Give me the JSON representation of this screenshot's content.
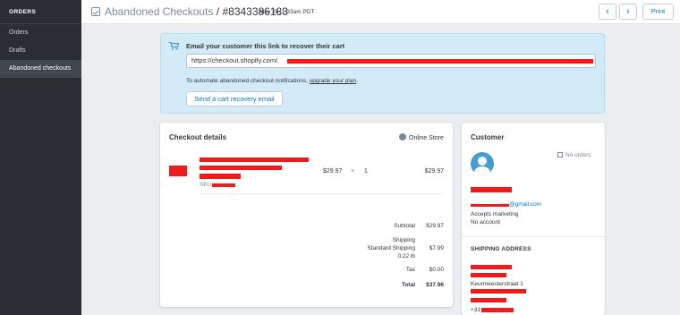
{
  "sidebar": {
    "header": "ORDERS",
    "items": [
      {
        "label": "Orders"
      },
      {
        "label": "Drafts"
      },
      {
        "label": "Abandoned checkouts"
      }
    ]
  },
  "topbar": {
    "breadcrumb": "Abandoned Checkouts",
    "separator": "/",
    "checkout_id": "#8343386183",
    "date": "May 26, 1:33am PDT",
    "prev_glyph": "‹",
    "next_glyph": "›",
    "print_label": "Print"
  },
  "recovery": {
    "title": "Email your customer this link to recover their cart",
    "link_value": "https://checkout.shopify.com/",
    "note_prefix": "To automate abandoned checkout notifications, ",
    "note_link": "upgrade your plan",
    "note_suffix": ".",
    "button_label": "Send a cart recovery email"
  },
  "checkout_details": {
    "title": "Checkout details",
    "channel": "Online Store",
    "line_item": {
      "sku_label": "SKU:",
      "price": "$29.97",
      "times": "×",
      "quantity": "1",
      "total": "$29.97"
    },
    "summary": {
      "subtotal_label": "Subtotal",
      "subtotal_value": "$29.97",
      "shipping_label": "Shipping",
      "shipping_method": "Standard Shipping",
      "shipping_weight": "0.22 lb",
      "shipping_value": "$7.99",
      "tax_label": "Tax",
      "tax_value": "$0.00",
      "total_label": "Total",
      "total_value": "$37.96"
    }
  },
  "customer": {
    "title": "Customer",
    "orders": "No orders",
    "email_suffix": "@gmail.com",
    "marketing": "Accepts marketing",
    "account": "No account",
    "shipping_title": "SHIPPING ADDRESS",
    "address_street": "Keurmeesterstraat 1",
    "phone_prefix": "+31"
  },
  "colors": {
    "sidebar_bg": "#2a2e33",
    "accent": "#0078bd",
    "alert_bg": "#d3ebf6",
    "redaction": "#f21a1a"
  }
}
